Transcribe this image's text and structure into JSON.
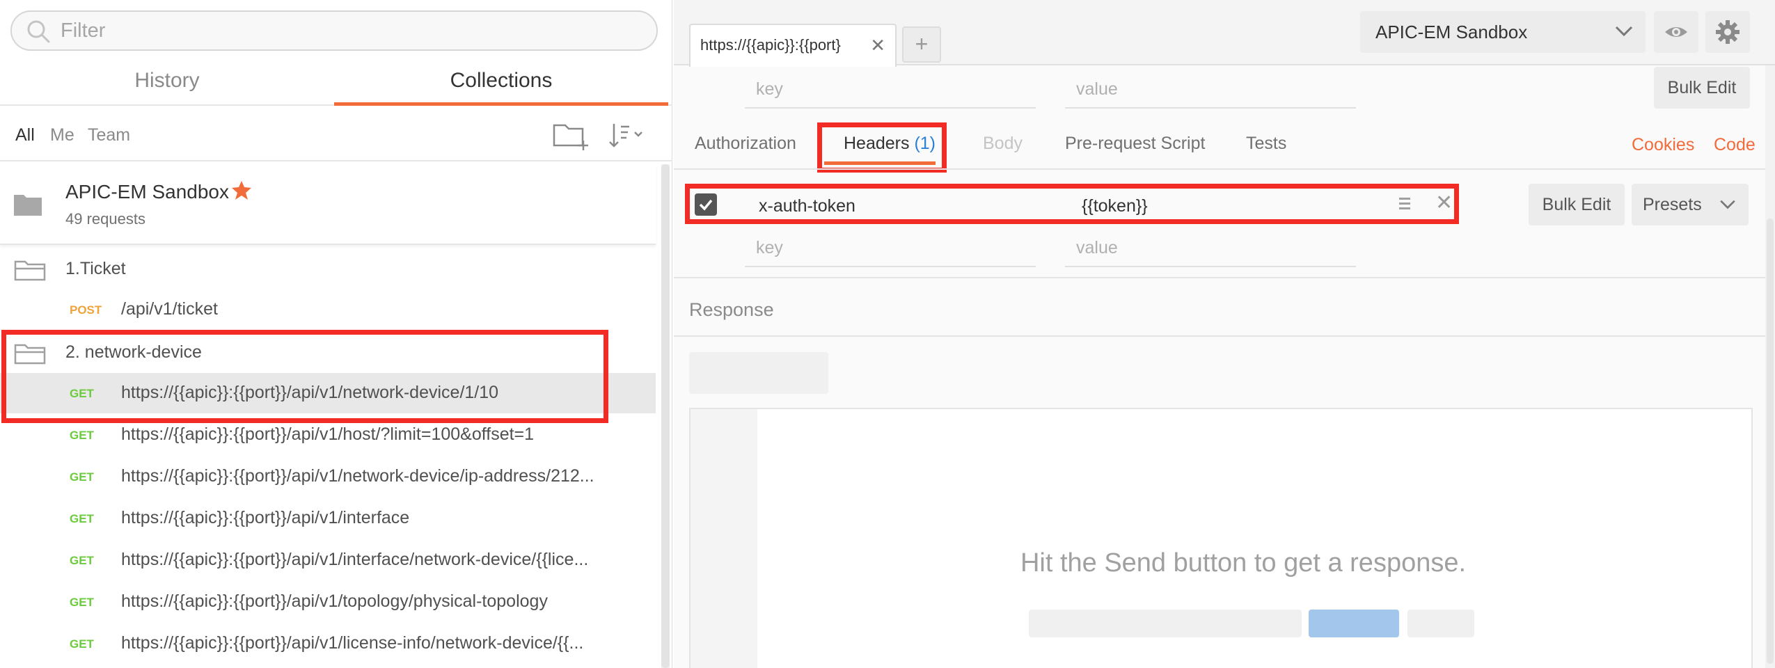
{
  "sidebar": {
    "filter_placeholder": "Filter",
    "tabs": [
      {
        "label": "History"
      },
      {
        "label": "Collections",
        "active": true
      }
    ],
    "subfilters": [
      {
        "label": "All",
        "active": true
      },
      {
        "label": "Me"
      },
      {
        "label": "Team"
      }
    ],
    "collection": {
      "name": "APIC-EM Sandbox",
      "count": "49 requests"
    },
    "tree": [
      {
        "type": "folder",
        "label": "1.Ticket"
      },
      {
        "type": "request",
        "method": "POST",
        "url": "/api/v1/ticket"
      },
      {
        "type": "folder",
        "label": "2. network-device"
      },
      {
        "type": "request",
        "method": "GET",
        "url": "https://{{apic}}:{{port}}/api/v1/network-device/1/10",
        "selected": true
      },
      {
        "type": "request",
        "method": "GET",
        "url": "https://{{apic}}:{{port}}/api/v1/host/?limit=100&offset=1"
      },
      {
        "type": "request",
        "method": "GET",
        "url": "https://{{apic}}:{{port}}/api/v1/network-device/ip-address/212..."
      },
      {
        "type": "request",
        "method": "GET",
        "url": "https://{{apic}}:{{port}}/api/v1/interface"
      },
      {
        "type": "request",
        "method": "GET",
        "url": "https://{{apic}}:{{port}}/api/v1/interface/network-device/{{lice..."
      },
      {
        "type": "request",
        "method": "GET",
        "url": "https://{{apic}}:{{port}}/api/v1/topology/physical-topology"
      },
      {
        "type": "request",
        "method": "GET",
        "url": "https://{{apic}}:{{port}}/api/v1/license-info/network-device/{{..."
      }
    ]
  },
  "topbar": {
    "request_tab_label": "https://{{apic}}:{{port}",
    "close_glyph": "✕",
    "add_glyph": "+",
    "environment": "APIC-EM Sandbox"
  },
  "params": {
    "key_placeholder": "key",
    "value_placeholder": "value",
    "bulk_edit": "Bulk Edit"
  },
  "request_tabs": {
    "authorization": "Authorization",
    "headers": "Headers",
    "headers_count": "(1)",
    "body": "Body",
    "prerequest": "Pre-request Script",
    "tests": "Tests",
    "cookies": "Cookies",
    "code": "Code"
  },
  "headers": {
    "rows": [
      {
        "key": "x-auth-token",
        "value": "{{token}}",
        "enabled": true
      }
    ],
    "key_placeholder": "key",
    "value_placeholder": "value",
    "bulk_edit": "Bulk Edit",
    "presets": "Presets"
  },
  "response": {
    "label": "Response",
    "empty_message": "Hit the Send button to get a response."
  },
  "colors": {
    "accent": "#f26b3a",
    "get": "#6bcb3c",
    "post": "#f0a33a",
    "highlight_box": "#f22b24",
    "link_blue": "#2a7fd6"
  }
}
